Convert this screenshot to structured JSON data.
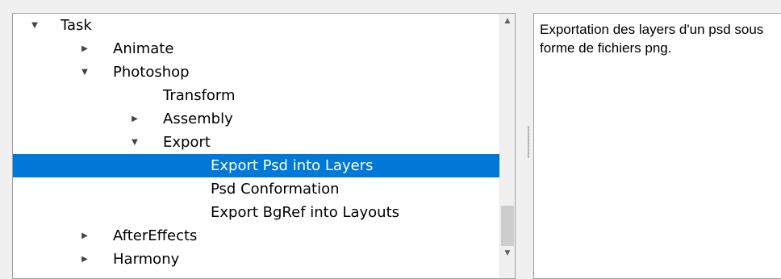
{
  "tree": {
    "rows": [
      {
        "label": "Task",
        "arrow": "▼"
      },
      {
        "label": "Animate",
        "arrow": "▶"
      },
      {
        "label": "Photoshop",
        "arrow": "▼"
      },
      {
        "label": "Transform",
        "arrow": ""
      },
      {
        "label": "Assembly",
        "arrow": "▶"
      },
      {
        "label": "Export",
        "arrow": "▼"
      },
      {
        "label": "Export Psd into Layers",
        "arrow": ""
      },
      {
        "label": "Psd Conformation",
        "arrow": ""
      },
      {
        "label": "Export BgRef into Layouts",
        "arrow": ""
      },
      {
        "label": "AfterEffects",
        "arrow": "▶"
      },
      {
        "label": "Harmony",
        "arrow": "▶"
      }
    ],
    "selected_label": "Export Psd into Layers"
  },
  "scrollbar": {
    "up_arrow": "▲",
    "down_arrow": "▼"
  },
  "description": {
    "text": "Exportation des layers d'un psd sous forme de fichiers png."
  },
  "colors": {
    "selection": "#0078d7",
    "panel_border": "#a0a0a0",
    "background": "#f0f0f0"
  }
}
